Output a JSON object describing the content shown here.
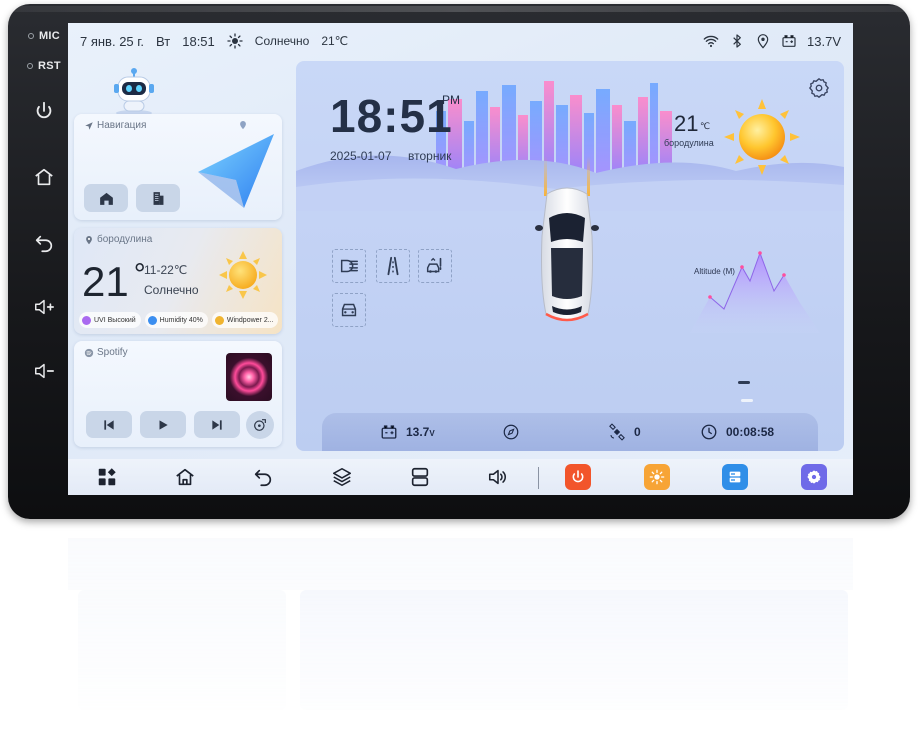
{
  "hardware_buttons": {
    "mic_label": "MIC",
    "rst_label": "RST"
  },
  "statusbar": {
    "date": "7 янв. 25 г.",
    "weekday": "Вт",
    "time": "18:51",
    "weather": "Солнечно",
    "temperature": "21℃",
    "battery": "13.7V"
  },
  "navigation_card": {
    "title": "Навигация"
  },
  "weather_card": {
    "location": "бородулина",
    "temperature": "21",
    "degree_symbol": "°",
    "range": "11-22℃",
    "condition": "Солнечно",
    "chips": [
      {
        "label": "UVI Высокий",
        "color": "#a96af0"
      },
      {
        "label": "Humidity 40%",
        "color": "#3b8ef0"
      },
      {
        "label": "Windpower 2...",
        "color": "#f0b430"
      }
    ]
  },
  "music_card": {
    "title": "Spotify"
  },
  "dashboard": {
    "clock": "18:51",
    "ampm": "PM",
    "date": "2025-01-07",
    "weekday": "вторник",
    "temperature": "21",
    "temperature_unit": "℃",
    "location": "бородулина",
    "altitude_label": "Altitude (M)",
    "voltage": "13.7",
    "voltage_unit": "V",
    "satellites": "0",
    "trip_time": "00:08:58"
  },
  "colors": {
    "power_button": "#f2552b",
    "brightness_button": "#f7a436",
    "split_button": "#2f8ee8",
    "settings_button": "#6f6ae8"
  },
  "bottombar": {
    "icons": [
      "apps-icon",
      "home-icon",
      "back-icon",
      "layers-icon",
      "split-screen-icon",
      "volume-icon",
      "power-icon",
      "brightness-icon",
      "split-view-icon",
      "settings-icon"
    ]
  }
}
